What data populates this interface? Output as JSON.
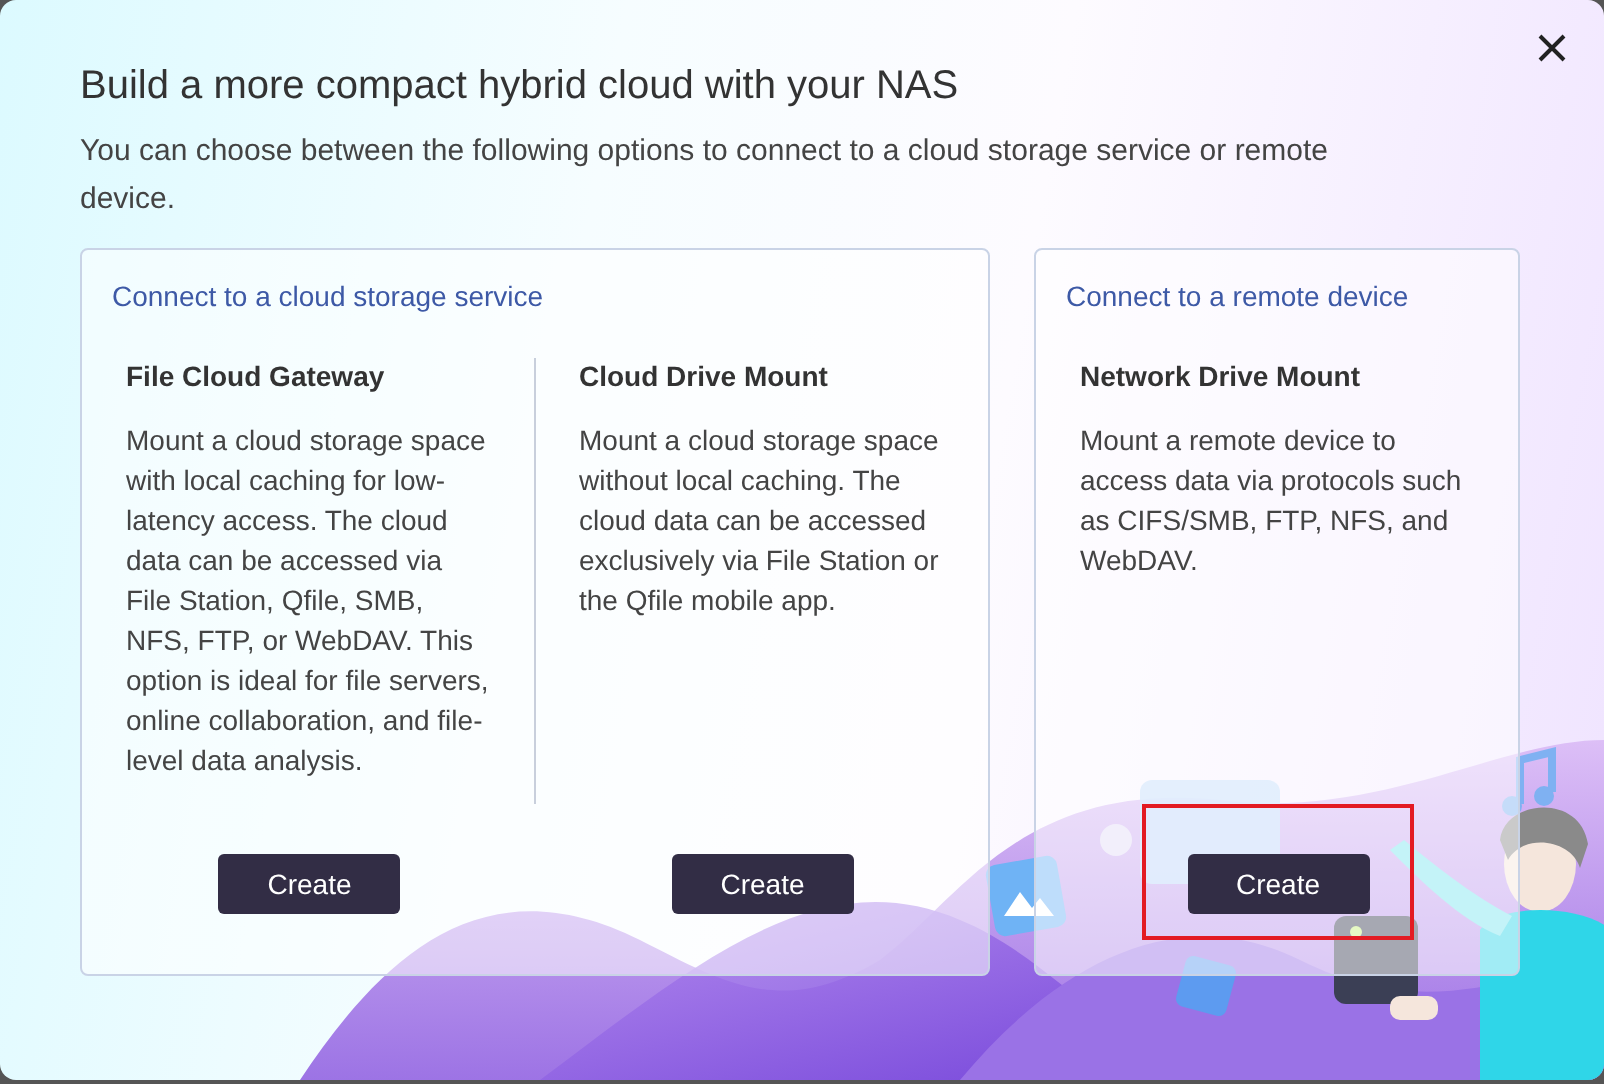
{
  "dialog": {
    "title": "Build a more compact hybrid cloud with your NAS",
    "subtitle": "You can choose between the following options to connect to a cloud storage service or remote device."
  },
  "groups": [
    {
      "heading": "Connect to a cloud storage service",
      "options": [
        {
          "title": "File Cloud Gateway",
          "description": "Mount a cloud storage space with local caching for low-latency access. The cloud data can be accessed via File Station, Qfile, SMB, NFS, FTP, or WebDAV. This option is ideal for file servers, online collaboration, and file-level data analysis.",
          "button": "Create",
          "highlighted": false
        },
        {
          "title": "Cloud Drive Mount",
          "description": "Mount a cloud storage space without local caching. The cloud data can be accessed exclusively via File Station or the Qfile mobile app.",
          "button": "Create",
          "highlighted": false
        }
      ]
    },
    {
      "heading": "Connect to a remote device",
      "options": [
        {
          "title": "Network Drive Mount",
          "description": "Mount a remote device to access data via protocols such as CIFS/SMB, FTP, NFS, and WebDAV.",
          "button": "Create",
          "highlighted": true
        }
      ]
    }
  ]
}
